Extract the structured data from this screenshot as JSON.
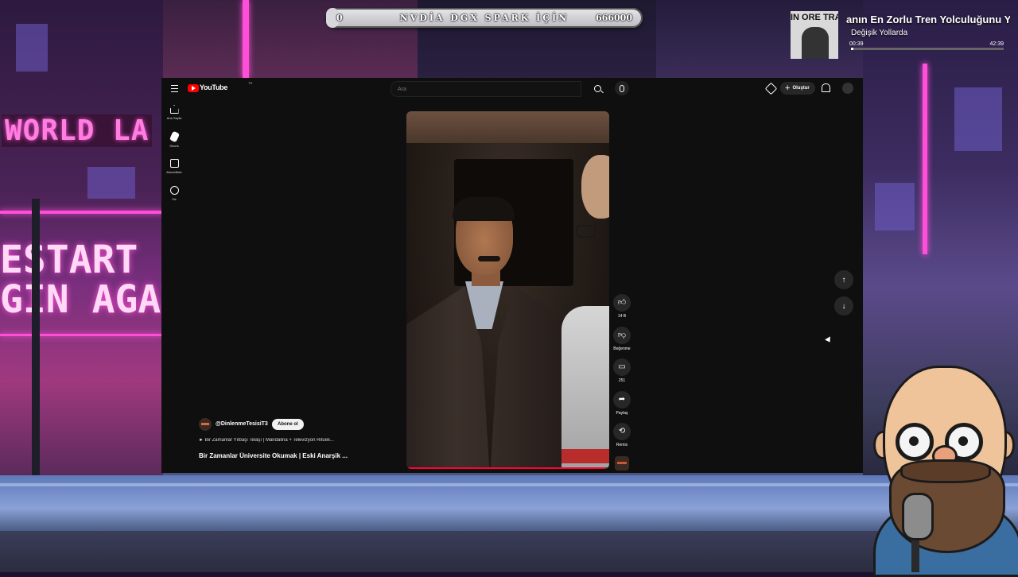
{
  "overlay": {
    "top_bar": {
      "start": "0",
      "title": "NVDİA DGX SPARK İÇİN",
      "end": "666000",
      "progress": 0.04
    },
    "now_playing": {
      "art_text": "IN ORE TRA",
      "title": "anın En Zorlu Tren Yolculuğunu Ya",
      "artist": "Değişik Yollarda",
      "current_time": "00:39",
      "total_time": "42:39",
      "progress": 0.015
    },
    "backdrop_signs": {
      "world": "WORLD LA",
      "restart_line1": "ESTART",
      "restart_line2": "GIN AGAIN"
    }
  },
  "youtube": {
    "logo": "YouTube",
    "logo_sup": "TR",
    "search": {
      "placeholder": "Ara"
    },
    "create_label": "Oluştur",
    "sidebar": [
      {
        "label": "Ana Sayfa",
        "icon": "home-icon"
      },
      {
        "label": "Shorts",
        "icon": "shorts-icon"
      },
      {
        "label": "Abonelikler",
        "icon": "subscriptions-icon"
      },
      {
        "label": "Siz",
        "icon": "you-icon"
      }
    ],
    "actions": {
      "like": "14 B",
      "dislike": "Beğenme",
      "comments": "251",
      "share": "Paylaş",
      "remix": "Remix"
    },
    "short": {
      "channel": "@DinlenmeTesisiT3",
      "subscribe_label": "Abone ol",
      "sound": "► Bir Zamanlar Yılbaşı Telaşı | Mandalina + Televizyon Ritüeli...",
      "title": "Bir Zamanlar Üniversite Okumak | Eski Anarşik ...",
      "progress": 0.98
    },
    "colors": {
      "accent": "#ff0000",
      "bg": "#0f0f0f",
      "button": "#272727"
    }
  }
}
